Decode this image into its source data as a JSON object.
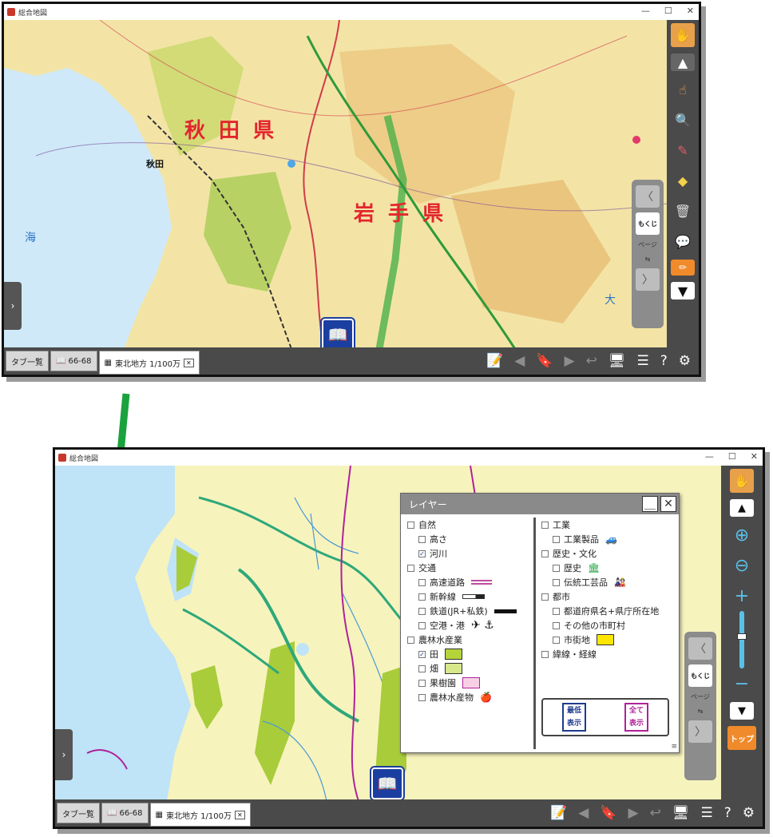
{
  "window1": {
    "title": "総合地図",
    "controls": [
      "—",
      "☐",
      "✕"
    ],
    "map_labels": {
      "pref_akita": "秋 田 県",
      "pref_iwate": "岩 手 県",
      "city_akita": "秋田",
      "sea": "海",
      "sea2": "大"
    },
    "toolbar": {
      "hand_icon": "✋",
      "up": "▲",
      "pointer": "☝",
      "search": "🔍",
      "pen": "✎",
      "shapes": "◆",
      "trash": "🗑",
      "chat": "💬",
      "memo": "✏",
      "down": "▼"
    },
    "pager": {
      "back": "〈",
      "mokuji": "もくじ",
      "page": "ページ",
      "fwd": "〉"
    },
    "statusbar": {
      "tab_list": "タブ一覧",
      "tab_pages": "66-68",
      "tab_active": "東北地方 1/100万",
      "icons": [
        "📝",
        "◀",
        "🔖",
        "▶",
        "↩",
        "🖥",
        "☰",
        "?",
        "⚙"
      ]
    }
  },
  "window2": {
    "title": "総合地図",
    "controls": [
      "—",
      "☐",
      "✕"
    ],
    "layer_panel": {
      "title": "レイヤー",
      "minimize": "＿",
      "close": "✕",
      "left_items": [
        {
          "label": "自然",
          "checked": false,
          "indent": 0
        },
        {
          "label": "高さ",
          "checked": false,
          "indent": 1
        },
        {
          "label": "河川",
          "checked": true,
          "indent": 1
        },
        {
          "label": "交通",
          "checked": false,
          "indent": 0
        },
        {
          "label": "高速道路",
          "checked": false,
          "indent": 1,
          "swatch": "hwy"
        },
        {
          "label": "新幹線",
          "checked": false,
          "indent": 1,
          "swatch": "shinkansen"
        },
        {
          "label": "鉄道(JR+私鉄)",
          "checked": false,
          "indent": 1,
          "swatch": "rail"
        },
        {
          "label": "空港・港",
          "checked": false,
          "indent": 1,
          "swatch": "airport"
        },
        {
          "label": "農林水産業",
          "checked": false,
          "indent": 0
        },
        {
          "label": "田",
          "checked": true,
          "indent": 1,
          "swatch": "rice"
        },
        {
          "label": "畑",
          "checked": false,
          "indent": 1,
          "swatch": "field"
        },
        {
          "label": "果樹園",
          "checked": false,
          "indent": 1,
          "swatch": "orchard"
        },
        {
          "label": "農林水産物",
          "checked": false,
          "indent": 1,
          "swatch": "produce"
        }
      ],
      "right_items": [
        {
          "label": "工業",
          "checked": false,
          "indent": 0
        },
        {
          "label": "工業製品",
          "checked": false,
          "indent": 1,
          "swatch": "industry"
        },
        {
          "label": "歴史・文化",
          "checked": false,
          "indent": 0
        },
        {
          "label": "歴史",
          "checked": false,
          "indent": 1,
          "swatch": "history"
        },
        {
          "label": "伝統工芸品",
          "checked": false,
          "indent": 1,
          "swatch": "craft"
        },
        {
          "label": "都市",
          "checked": false,
          "indent": 0
        },
        {
          "label": "都道府県名+県庁所在地",
          "checked": false,
          "indent": 1
        },
        {
          "label": "その他の市町村",
          "checked": false,
          "indent": 1
        },
        {
          "label": "市街地",
          "checked": false,
          "indent": 1,
          "swatch": "urban"
        },
        {
          "label": "緯線・経線",
          "checked": false,
          "indent": 0
        }
      ],
      "btn_minimal": "最低表示",
      "btn_all": "全て表示",
      "colors": {
        "minimal": "#1f3b8f",
        "all": "#b0229a"
      }
    },
    "toolbar": {
      "hand_icon": "✋",
      "up": "▲",
      "zoom_area": "⊕",
      "zoom_out_area": "⊖",
      "zoom_in": "+",
      "zoom_out": "−",
      "down": "▼",
      "top_label": "トップ"
    },
    "pager": {
      "back": "〈",
      "mokuji": "もくじ",
      "page": "ページ",
      "fwd": "〉"
    },
    "statusbar": {
      "tab_list": "タブ一覧",
      "tab_pages": "66-68",
      "tab_active": "東北地方 1/100万",
      "icons": [
        "📝",
        "◀",
        "🔖",
        "▶",
        "↩",
        "🖥",
        "☰",
        "?",
        "⚙"
      ]
    }
  },
  "colors": {
    "toolbar_bg": "#4a4a4a",
    "hand_btn": "#e8a04a",
    "top_btn": "#f08a2a",
    "sea": "#bfe3f7",
    "land": "#f7efb7",
    "arrow": "#1aa33c"
  }
}
